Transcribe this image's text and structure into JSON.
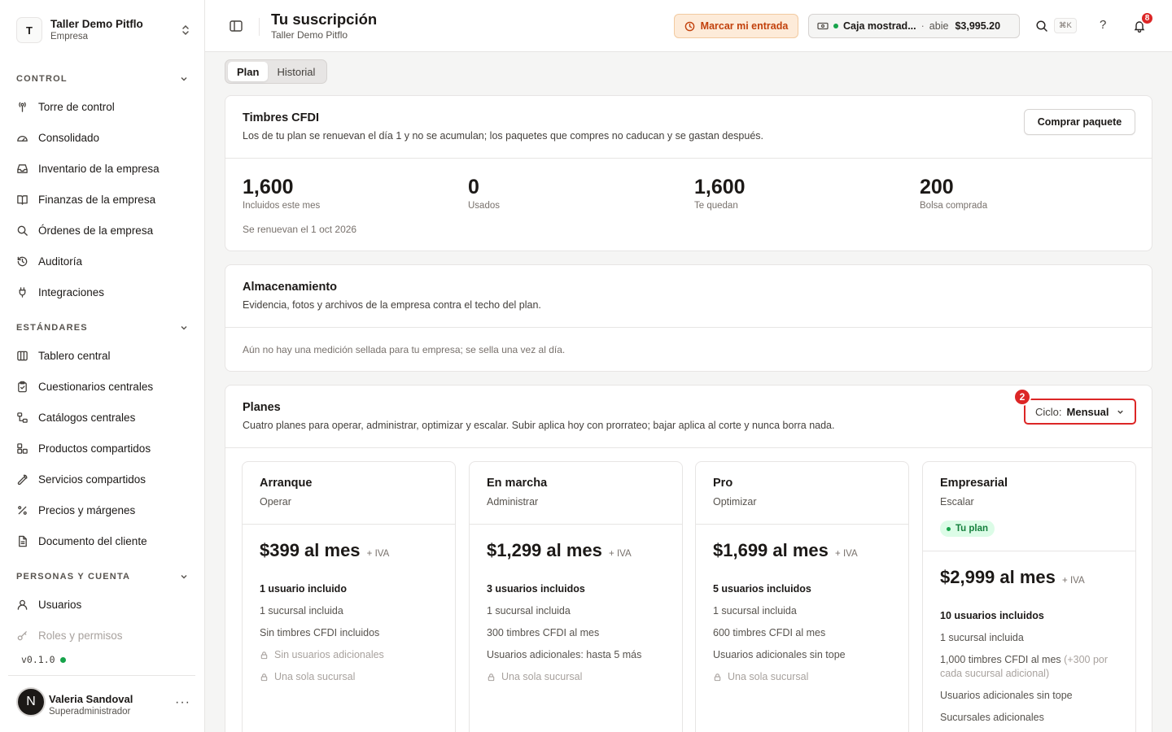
{
  "org": {
    "initial": "T",
    "name": "Taller Demo Pitflo",
    "type": "Empresa"
  },
  "sidebar": {
    "sections": [
      {
        "title": "CONTROL",
        "items": [
          {
            "label": "Torre de control",
            "icon": "antenna-icon"
          },
          {
            "label": "Consolidado",
            "icon": "gauge-icon"
          },
          {
            "label": "Inventario de la empresa",
            "icon": "inbox-icon"
          },
          {
            "label": "Finanzas de la empresa",
            "icon": "book-icon"
          },
          {
            "label": "Órdenes de la empresa",
            "icon": "search-icon"
          },
          {
            "label": "Auditoría",
            "icon": "history-icon"
          },
          {
            "label": "Integraciones",
            "icon": "plug-icon"
          }
        ]
      },
      {
        "title": "ESTÁNDARES",
        "items": [
          {
            "label": "Tablero central",
            "icon": "columns-icon"
          },
          {
            "label": "Cuestionarios centrales",
            "icon": "clipboard-icon"
          },
          {
            "label": "Catálogos centrales",
            "icon": "hierarchy-icon"
          },
          {
            "label": "Productos compartidos",
            "icon": "boxes-icon"
          },
          {
            "label": "Servicios compartidos",
            "icon": "wrench-icon"
          },
          {
            "label": "Precios y márgenes",
            "icon": "percent-icon"
          },
          {
            "label": "Documento del cliente",
            "icon": "document-icon"
          }
        ]
      },
      {
        "title": "PERSONAS Y CUENTA",
        "items": [
          {
            "label": "Usuarios",
            "icon": "user-icon"
          },
          {
            "label": "Roles y permisos",
            "icon": "key-icon"
          }
        ]
      }
    ],
    "version": "v0.1.0",
    "user": {
      "initial": "N",
      "name": "Valeria Sandoval",
      "role": "Superadministrador"
    }
  },
  "header": {
    "title": "Tu suscripción",
    "subtitle": "Taller Demo Pitflo",
    "clock_in_label": "Marcar mi entrada",
    "register": {
      "name": "Caja mostrad...",
      "status": "abie",
      "amount": "$3,995.20"
    },
    "search_shortcut": "⌘K",
    "help_label": "?",
    "notifications_count": "8"
  },
  "tabs": [
    {
      "label": "Plan",
      "active": true
    },
    {
      "label": "Historial",
      "active": false
    }
  ],
  "stamps": {
    "title": "Timbres CFDI",
    "description": "Los de tu plan se renuevan el día 1 y no se acumulan; los paquetes que compres no caducan y se gastan después.",
    "buy_label": "Comprar paquete",
    "stats": [
      {
        "value": "1,600",
        "label": "Incluidos este mes"
      },
      {
        "value": "0",
        "label": "Usados"
      },
      {
        "value": "1,600",
        "label": "Te quedan"
      },
      {
        "value": "200",
        "label": "Bolsa comprada"
      }
    ],
    "renew_note": "Se renuevan el 1 oct 2026"
  },
  "storage": {
    "title": "Almacenamiento",
    "description": "Evidencia, fotos y archivos de la empresa contra el techo del plan.",
    "empty_message": "Aún no hay una medición sellada para tu empresa; se sella una vez al día."
  },
  "plans": {
    "title": "Planes",
    "description": "Cuatro planes para operar, administrar, optimizar y escalar. Subir aplica hoy con prorrateo; bajar aplica al corte y nunca borra nada.",
    "cycle_label": "Ciclo:",
    "cycle_value": "Mensual",
    "marker": "2",
    "items": [
      {
        "name": "Arranque",
        "tagline": "Operar",
        "price": "$399 al mes",
        "tax": "+ IVA",
        "current": false,
        "users": "1 usuario incluido",
        "features": [
          {
            "text": "1 sucursal incluida",
            "locked": false
          },
          {
            "text": "Sin timbres CFDI incluidos",
            "locked": false
          },
          {
            "text": "Sin usuarios adicionales",
            "locked": true
          },
          {
            "text": "Una sola sucursal",
            "locked": true
          }
        ]
      },
      {
        "name": "En marcha",
        "tagline": "Administrar",
        "price": "$1,299 al mes",
        "tax": "+ IVA",
        "current": false,
        "users": "3 usuarios incluidos",
        "features": [
          {
            "text": "1 sucursal incluida",
            "locked": false
          },
          {
            "text": "300 timbres CFDI al mes",
            "locked": false
          },
          {
            "text": "Usuarios adicionales: hasta 5 más",
            "locked": false
          },
          {
            "text": "Una sola sucursal",
            "locked": true
          }
        ]
      },
      {
        "name": "Pro",
        "tagline": "Optimizar",
        "price": "$1,699 al mes",
        "tax": "+ IVA",
        "current": false,
        "users": "5 usuarios incluidos",
        "features": [
          {
            "text": "1 sucursal incluida",
            "locked": false
          },
          {
            "text": "600 timbres CFDI al mes",
            "locked": false
          },
          {
            "text": "Usuarios adicionales sin tope",
            "locked": false
          },
          {
            "text": "Una sola sucursal",
            "locked": true
          }
        ]
      },
      {
        "name": "Empresarial",
        "tagline": "Escalar",
        "price": "$2,999 al mes",
        "tax": "+ IVA",
        "current": true,
        "badge": "Tu plan",
        "users": "10 usuarios incluidos",
        "features": [
          {
            "text": "1 sucursal incluida",
            "locked": false
          },
          {
            "text": "1,000 timbres CFDI al mes",
            "extra": "(+300 por cada sucursal adicional)",
            "locked": false
          },
          {
            "text": "Usuarios adicionales sin tope",
            "locked": false
          },
          {
            "text": "Sucursales adicionales",
            "locked": false
          }
        ]
      }
    ]
  }
}
